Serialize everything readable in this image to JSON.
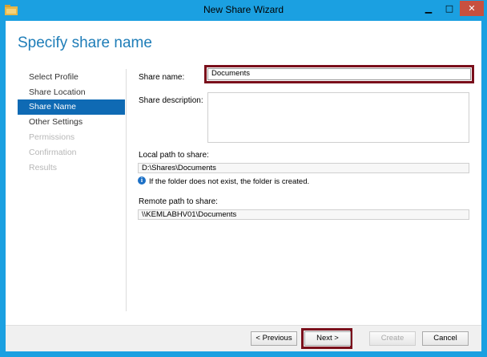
{
  "window": {
    "title": "New Share Wizard",
    "minimize_glyph": "▁",
    "maximize_glyph": "□",
    "close_glyph": "✕",
    "icon": "folder-share-icon"
  },
  "page": {
    "title": "Specify share name"
  },
  "nav": {
    "items": [
      {
        "label": "Select Profile",
        "state": "normal"
      },
      {
        "label": "Share Location",
        "state": "normal"
      },
      {
        "label": "Share Name",
        "state": "selected"
      },
      {
        "label": "Other Settings",
        "state": "normal"
      },
      {
        "label": "Permissions",
        "state": "disabled"
      },
      {
        "label": "Confirmation",
        "state": "disabled"
      },
      {
        "label": "Results",
        "state": "disabled"
      }
    ]
  },
  "form": {
    "share_name_label": "Share name:",
    "share_name_value": "Documents",
    "share_description_label": "Share description:",
    "share_description_value": "",
    "local_path_label": "Local path to share:",
    "local_path_value": "D:\\Shares\\Documents",
    "info_text": "If the folder does not exist, the folder is created.",
    "remote_path_label": "Remote path to share:",
    "remote_path_value": "\\\\KEMLABHV01\\Documents"
  },
  "buttons": {
    "previous": "< Previous",
    "next": "Next >",
    "create": "Create",
    "cancel": "Cancel"
  },
  "colors": {
    "window_frame": "#1ba0e1",
    "page_title": "#1e7db8",
    "nav_selected": "#0f6ab4",
    "highlight": "#7a0f1b",
    "close_button": "#c7503f"
  }
}
